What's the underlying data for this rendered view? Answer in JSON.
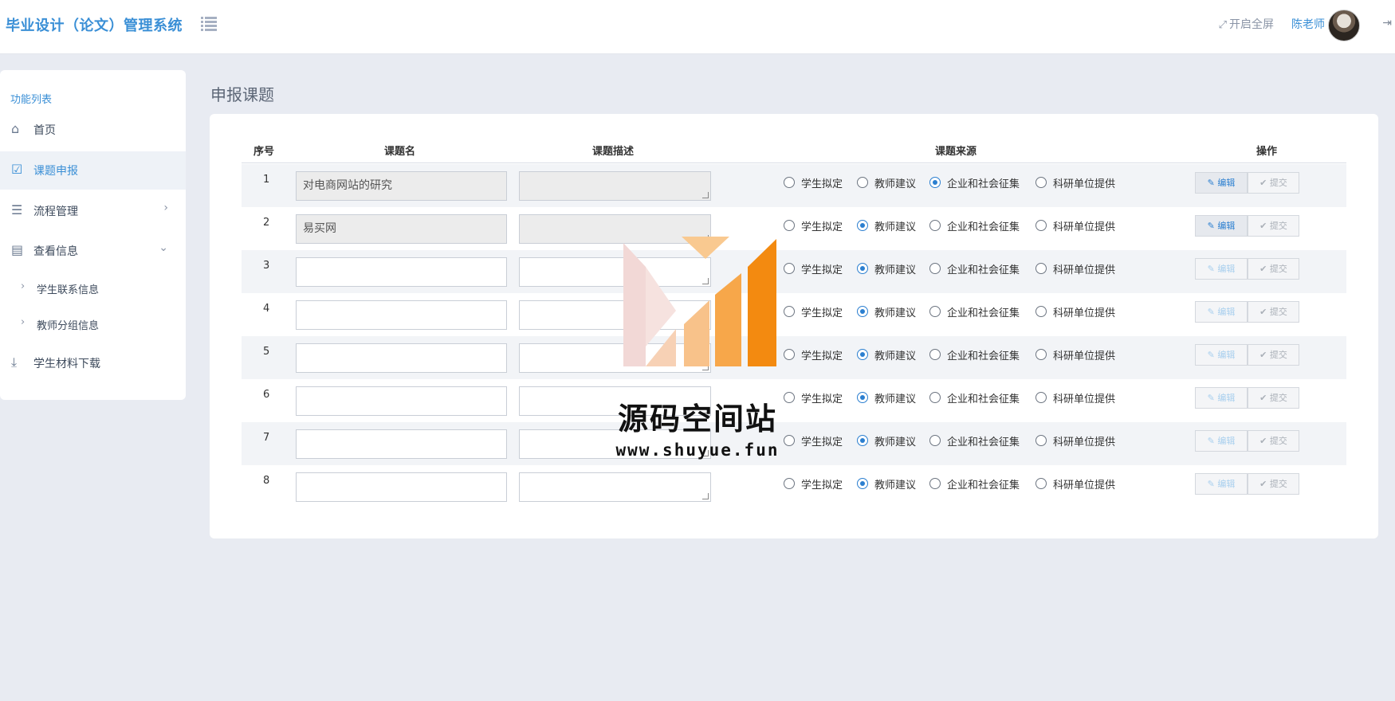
{
  "header": {
    "brand": "毕业设计（论文）管理系统",
    "fullscreen_label": "开启全屏",
    "username": "陈老师"
  },
  "sidebar": {
    "title": "功能列表",
    "items": [
      {
        "label": "首页",
        "icon": "home-icon"
      },
      {
        "label": "课题申报",
        "icon": "checkbox-icon",
        "active": true
      },
      {
        "label": "流程管理",
        "icon": "list-server-icon"
      },
      {
        "label": "查看信息",
        "icon": "calendar-icon"
      },
      {
        "label": "学生材料下载",
        "icon": "download-icon"
      }
    ],
    "sub_items": [
      {
        "label": "学生联系信息"
      },
      {
        "label": "教师分组信息"
      }
    ]
  },
  "main": {
    "title": "申报课题",
    "columns": {
      "num": "序号",
      "name": "课题名",
      "desc": "课题描述",
      "source": "课题来源",
      "action": "操作"
    },
    "source_options": [
      "学生拟定",
      "教师建议",
      "企业和社会征集",
      "科研单位提供"
    ],
    "edit_label": "编辑",
    "submit_label": "提交",
    "rows": [
      {
        "num": "1",
        "name": "对电商网站的研究",
        "selected": "企业和社会征集"
      },
      {
        "num": "2",
        "name": "易买网",
        "selected": "教师建议"
      },
      {
        "num": "3",
        "name": "",
        "selected": "教师建议"
      },
      {
        "num": "4",
        "name": "",
        "selected": "教师建议"
      },
      {
        "num": "5",
        "name": "",
        "selected": "教师建议"
      },
      {
        "num": "6",
        "name": "",
        "selected": "教师建议"
      },
      {
        "num": "7",
        "name": "",
        "selected": "教师建议"
      },
      {
        "num": "8",
        "name": "",
        "selected": "教师建议"
      }
    ]
  },
  "watermark": {
    "title": "源码空间站",
    "url": "www.shuyue.fun"
  }
}
